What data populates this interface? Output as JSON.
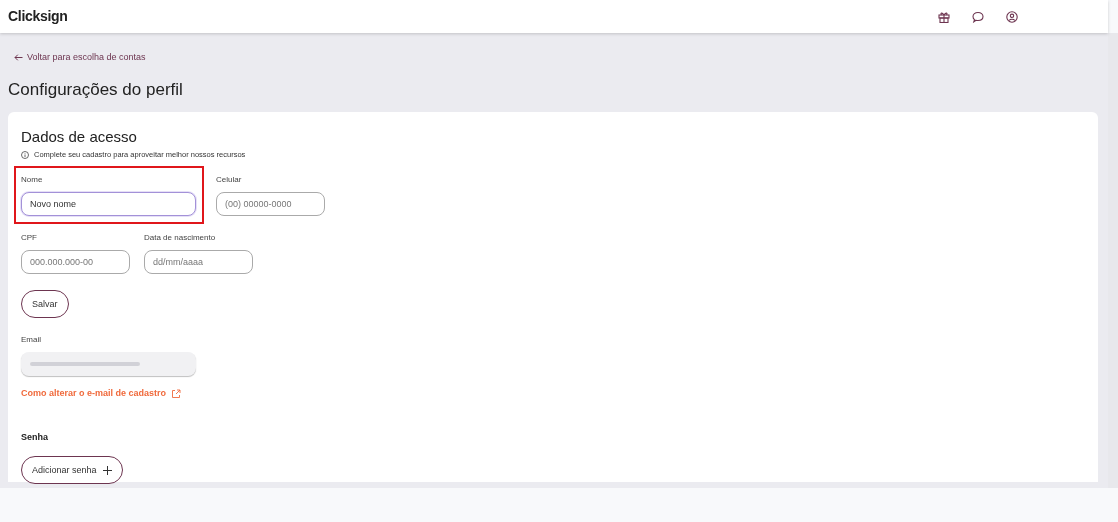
{
  "header": {
    "logo": "Clicksign"
  },
  "back_link": {
    "label": "Voltar para escolha de contas"
  },
  "page_title": "Configurações do perfil",
  "card": {
    "title": "Dados de acesso",
    "info": "Complete seu cadastro para aproveitar melhor nossos recursos",
    "field_rows": [
      [
        {
          "label": "Nome",
          "value": "Novo nome",
          "highlighted": true,
          "focused": true
        },
        {
          "label": "Celular",
          "placeholder": "(00) 00000-0000",
          "highlighted": false,
          "focused": false
        }
      ],
      [
        {
          "label": "CPF",
          "placeholder": "000.000.000-00",
          "highlighted": false,
          "focused": false
        },
        {
          "label": "Data de nascimento",
          "placeholder": "dd/mm/aaaa",
          "highlighted": false,
          "focused": false
        }
      ]
    ],
    "save_button": "Salvar",
    "email": {
      "label": "Email",
      "disabled": true
    },
    "email_help_link": "Como alterar o e-mail de cadastro",
    "password": {
      "label": "Senha",
      "button": "Adicionar senha"
    }
  }
}
